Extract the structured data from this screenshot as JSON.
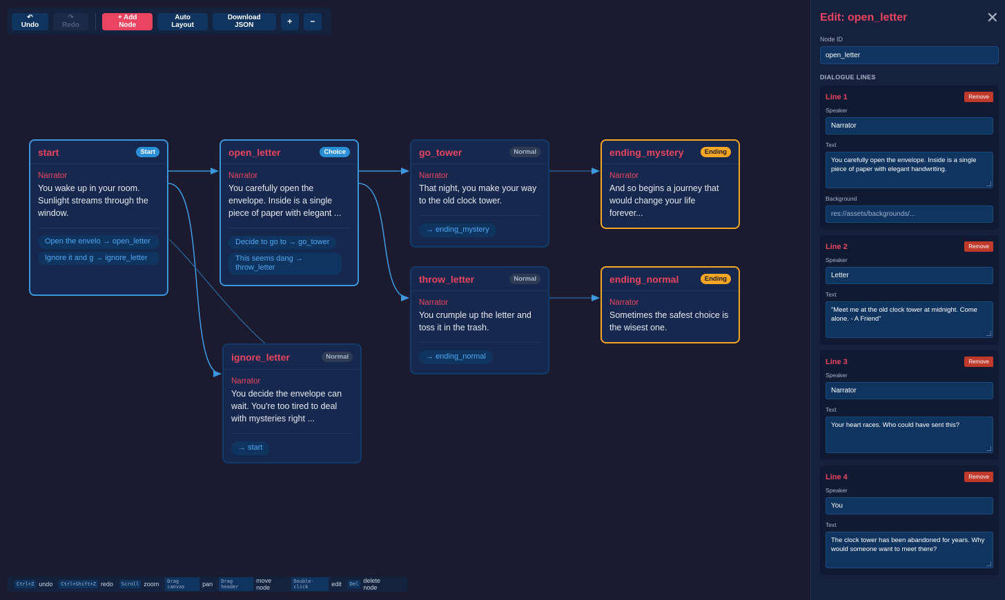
{
  "toolbar": {
    "undo": "↶ Undo",
    "redo": "↷ Redo",
    "add_node": "+ Add Node",
    "auto_layout": "Auto Layout",
    "download": "Download JSON",
    "zoom_in": "+",
    "zoom_out": "−"
  },
  "nodes": {
    "start": {
      "title": "start",
      "badge": "Start",
      "speaker": "Narrator",
      "text": "You wake up in your room. Sunlight streams through the window.",
      "choices": [
        {
          "label": "Open the envelo",
          "target": "open_letter"
        },
        {
          "label": "Ignore it and g",
          "target": "ignore_letter"
        }
      ]
    },
    "open_letter": {
      "title": "open_letter",
      "badge": "Choice",
      "speaker": "Narrator",
      "text": "You carefully open the envelope. Inside is a single piece of paper with elegant ...",
      "choices": [
        {
          "label": "Decide to go to",
          "target": "go_tower"
        },
        {
          "label": "This seems dang",
          "target": "throw_letter"
        }
      ]
    },
    "go_tower": {
      "title": "go_tower",
      "badge": "Normal",
      "speaker": "Narrator",
      "text": "That night, you make your way to the old clock tower.",
      "next": "ending_mystery"
    },
    "ending_mystery": {
      "title": "ending_mystery",
      "badge": "Ending",
      "speaker": "Narrator",
      "text": "And so begins a journey that would change your life forever..."
    },
    "throw_letter": {
      "title": "throw_letter",
      "badge": "Normal",
      "speaker": "Narrator",
      "text": "You crumple up the letter and toss it in the trash.",
      "next": "ending_normal"
    },
    "ending_normal": {
      "title": "ending_normal",
      "badge": "Ending",
      "speaker": "Narrator",
      "text": "Sometimes the safest choice is the wisest one."
    },
    "ignore_letter": {
      "title": "ignore_letter",
      "badge": "Normal",
      "speaker": "Narrator",
      "text": "You decide the envelope can wait. You're too tired to deal with mysteries right ...",
      "next": "start"
    }
  },
  "arrow_glyph": "→",
  "shortcuts": [
    {
      "key": "Ctrl+Z",
      "desc": "undo"
    },
    {
      "key": "Ctrl+Shift+Z",
      "desc": "redo"
    },
    {
      "key": "Scroll",
      "desc": "zoom"
    },
    {
      "key": "Drag canvas",
      "desc": "pan"
    },
    {
      "key": "Drag header",
      "desc": "move node"
    },
    {
      "key": "Double-click",
      "desc": "edit"
    },
    {
      "key": "Del",
      "desc": "delete node"
    }
  ],
  "panel": {
    "title": "Edit: open_letter",
    "close": "✕",
    "node_id_label": "Node ID",
    "node_id_value": "open_letter",
    "lines_label": "DIALOGUE LINES",
    "remove_label": "Remove",
    "speaker_label": "Speaker",
    "text_label": "Text",
    "background_label": "Background",
    "lines": [
      {
        "title": "Line 1",
        "speaker": "Narrator",
        "text": "You carefully open the envelope. Inside is a single piece of paper with elegant handwriting.",
        "background": "res://assets/backgrounds/..."
      },
      {
        "title": "Line 2",
        "speaker": "Letter",
        "text": "\"Meet me at the old clock tower at midnight. Come alone. - A Friend\""
      },
      {
        "title": "Line 3",
        "speaker": "Narrator",
        "text": "Your heart races. Who could have sent this?"
      },
      {
        "title": "Line 4",
        "speaker": "You",
        "text": "The clock tower has been abandoned for years. Why would someone want to meet there?"
      }
    ]
  },
  "colors": {
    "accent": "#e94560",
    "edge": "#3c97dd",
    "ending": "#f5a623",
    "background": "#1b1a2e"
  }
}
